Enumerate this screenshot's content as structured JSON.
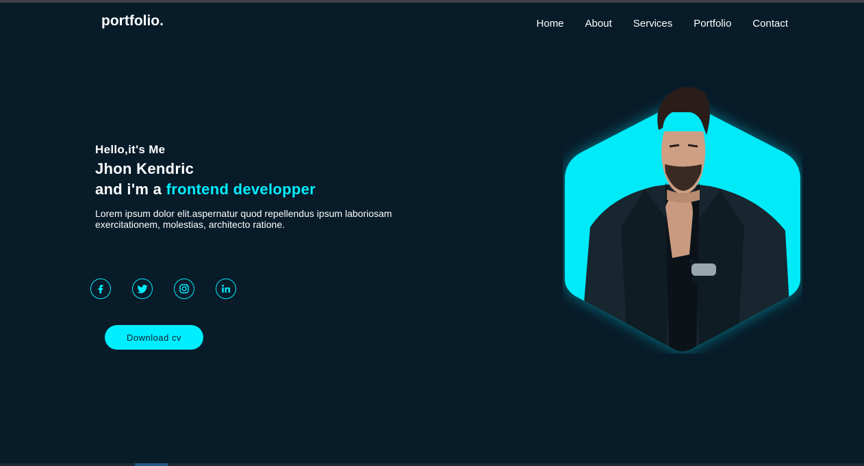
{
  "header": {
    "logo": "portfolio.",
    "nav": [
      "Home",
      "About",
      "Services",
      "Portfolio",
      "Contact"
    ]
  },
  "hero": {
    "greeting": "Hello,it's Me",
    "name": "Jhon Kendric",
    "role_prefix": "and i'm a ",
    "role": "frontend developper",
    "description": "Lorem ipsum dolor elit.aspernatur quod repellendus ipsum laboriosam exercitationem, molestias, architecto ratione.",
    "button_label": "Download cv"
  },
  "socials": [
    "facebook-icon",
    "twitter-icon",
    "instagram-icon",
    "linkedin-icon"
  ],
  "colors": {
    "background": "#081b29",
    "accent": "#00eeff",
    "text": "#ffffff"
  }
}
